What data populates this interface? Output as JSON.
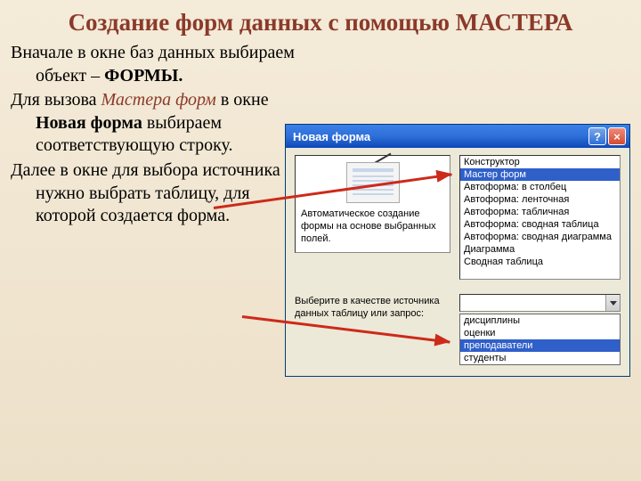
{
  "title": "Создание форм данных с помощью МАСТЕРА",
  "text": {
    "p1a": "Вначале в окне баз данных выбираем объект – ",
    "p1b": "ФОРМЫ.",
    "p2a": "Для вызова ",
    "p2b": "Мастера форм",
    "p2c": " в окне ",
    "p2d": "Новая форма",
    "p2e": " выбираем соответствующую строку.",
    "p3": "Далее в окне для выбора источника нужно выбрать таблицу, для которой создается форма."
  },
  "dialog": {
    "title": "Новая форма",
    "help": "?",
    "close": "×",
    "preview_desc": "Автоматическое создание формы на основе выбранных полей.",
    "form_types": [
      "Конструктор",
      "Мастер форм",
      "Автоформа: в столбец",
      "Автоформа: ленточная",
      "Автоформа: табличная",
      "Автоформа:  сводная таблица",
      "Автоформа:  сводная диаграмма",
      "Диаграмма",
      "Сводная таблица"
    ],
    "selected_type_index": 1,
    "source_label": "Выберите в качестве источника данных таблицу или запрос:",
    "combo_value": "",
    "sources": [
      "дисциплины",
      "оценки",
      "преподаватели",
      "студенты"
    ],
    "selected_source_index": 2
  }
}
